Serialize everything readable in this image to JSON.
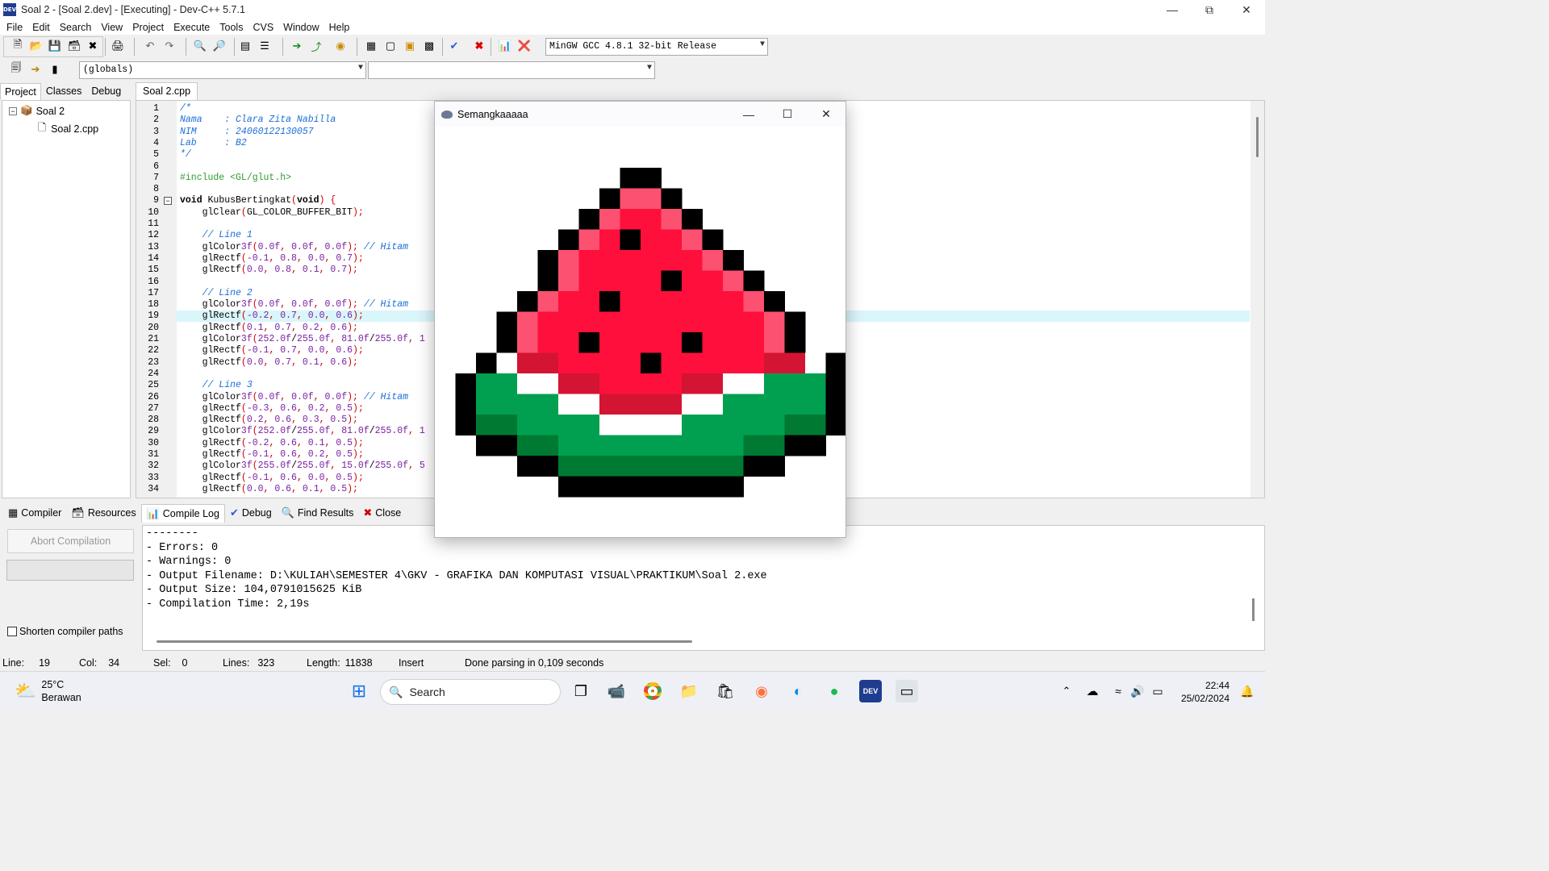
{
  "titlebar": {
    "title": "Soal 2 - [Soal 2.dev] - [Executing] - Dev-C++ 5.7.1",
    "app_icon_text": "DEV"
  },
  "menu": [
    "File",
    "Edit",
    "Search",
    "View",
    "Project",
    "Execute",
    "Tools",
    "CVS",
    "Window",
    "Help"
  ],
  "toolbar": {
    "compiler_select": "MinGW GCC 4.8.1 32-bit Release",
    "scope_select": "(globals)",
    "function_select": ""
  },
  "left_panel": {
    "tabs": [
      "Project",
      "Classes",
      "Debug"
    ],
    "active_tab": "Project",
    "tree": [
      {
        "label": "Soal 2",
        "type": "project"
      },
      {
        "label": "Soal 2.cpp",
        "type": "file"
      }
    ]
  },
  "editor": {
    "tab": "Soal 2.cpp",
    "lines": [
      {
        "n": "1",
        "text": "/*"
      },
      {
        "n": "2",
        "text": "Nama    : Clara Zita Nabilla"
      },
      {
        "n": "3",
        "text": "NIM     : 24060122130057"
      },
      {
        "n": "4",
        "text": "Lab     : B2"
      },
      {
        "n": "5",
        "text": "*/"
      },
      {
        "n": "6",
        "text": ""
      },
      {
        "n": "7",
        "text": "#include <GL/glut.h>"
      },
      {
        "n": "8",
        "text": ""
      },
      {
        "n": "9",
        "text": "void KubusBertingkat(void) {"
      },
      {
        "n": "10",
        "text": "    glClear(GL_COLOR_BUFFER_BIT);"
      },
      {
        "n": "11",
        "text": ""
      },
      {
        "n": "12",
        "text": "    // Line 1"
      },
      {
        "n": "13",
        "text": "    glColor3f(0.0f, 0.0f, 0.0f); // Hitam"
      },
      {
        "n": "14",
        "text": "    glRectf(-0.1, 0.8, 0.0, 0.7);"
      },
      {
        "n": "15",
        "text": "    glRectf(0.0, 0.8, 0.1, 0.7);"
      },
      {
        "n": "16",
        "text": ""
      },
      {
        "n": "17",
        "text": "    // Line 2"
      },
      {
        "n": "18",
        "text": "    glColor3f(0.0f, 0.0f, 0.0f); // Hitam"
      },
      {
        "n": "19",
        "text": "    glRectf(-0.2, 0.7, 0.0, 0.6);"
      },
      {
        "n": "20",
        "text": "    glRectf(0.1, 0.7, 0.2, 0.6);"
      },
      {
        "n": "21",
        "text": "    glColor3f(252.0f/255.0f, 81.0f/255.0f, 1"
      },
      {
        "n": "22",
        "text": "    glRectf(-0.1, 0.7, 0.0, 0.6);"
      },
      {
        "n": "23",
        "text": "    glRectf(0.0, 0.7, 0.1, 0.6);"
      },
      {
        "n": "24",
        "text": ""
      },
      {
        "n": "25",
        "text": "    // Line 3"
      },
      {
        "n": "26",
        "text": "    glColor3f(0.0f, 0.0f, 0.0f); // Hitam"
      },
      {
        "n": "27",
        "text": "    glRectf(-0.3, 0.6, 0.2, 0.5);"
      },
      {
        "n": "28",
        "text": "    glRectf(0.2, 0.6, 0.3, 0.5);"
      },
      {
        "n": "29",
        "text": "    glColor3f(252.0f/255.0f, 81.0f/255.0f, 1"
      },
      {
        "n": "30",
        "text": "    glRectf(-0.2, 0.6, 0.1, 0.5);"
      },
      {
        "n": "31",
        "text": "    glRectf(-0.1, 0.6, 0.2, 0.5);"
      },
      {
        "n": "32",
        "text": "    glColor3f(255.0f/255.0f, 15.0f/255.0f, 5"
      },
      {
        "n": "33",
        "text": "    glRectf(-0.1, 0.6, 0.0, 0.5);"
      },
      {
        "n": "34",
        "text": "    glRectf(0.0, 0.6, 0.1, 0.5);"
      }
    ]
  },
  "bottom_panel": {
    "tabs": [
      "Compiler",
      "Resources",
      "Compile Log",
      "Debug",
      "Find Results",
      "Close"
    ],
    "active_tab": "Compile Log",
    "abort_button": "Abort Compilation",
    "shorten_paths": "Shorten compiler paths",
    "log": [
      "--------",
      "- Errors: 0",
      "- Warnings: 0",
      "- Output Filename: D:\\KULIAH\\SEMESTER 4\\GKV - GRAFIKA DAN KOMPUTASI VISUAL\\PRAKTIKUM\\Soal 2.exe",
      "- Output Size: 104,0791015625 KiB",
      "- Compilation Time: 2,19s"
    ]
  },
  "statusbar": {
    "line_label": "Line:",
    "line": "19",
    "col_label": "Col:",
    "col": "34",
    "sel_label": "Sel:",
    "sel": "0",
    "lines_label": "Lines:",
    "lines": "323",
    "length_label": "Length:",
    "length": "11838",
    "mode": "Insert",
    "message": "Done parsing in 0,109 seconds"
  },
  "gl_window": {
    "title": "Semangkaaaaa",
    "colors": {
      "black": "#000000",
      "pink": "#fc5170",
      "red": "#ff0f3c",
      "darkred": "#d41433",
      "white": "#ffffff",
      "green": "#00a050",
      "darkgreen": "#007a33"
    }
  },
  "taskbar": {
    "weather_temp": "25°C",
    "weather_desc": "Berawan",
    "search_placeholder": "Search",
    "time": "22:44",
    "date": "25/02/2024"
  }
}
